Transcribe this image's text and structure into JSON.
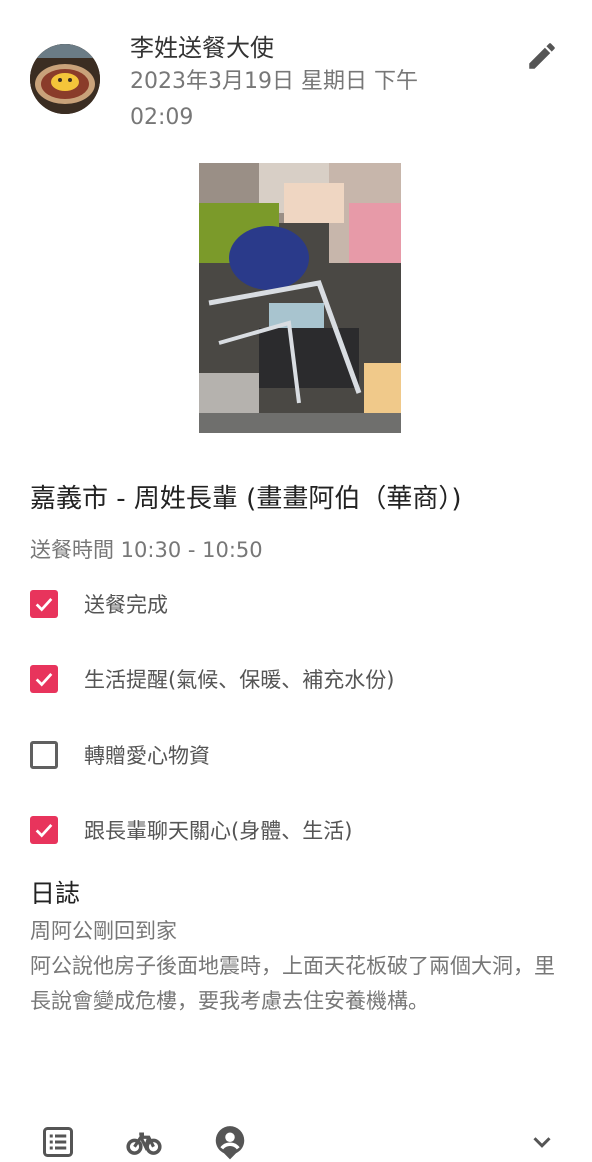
{
  "header": {
    "author_name": "李姓送餐大使",
    "date_line1": "2023年3月19日 星期日 下午",
    "date_line2": "02:09"
  },
  "post": {
    "title": "嘉義市 - 周姓長輩 (畫畫阿伯（華商）)",
    "schedule": "送餐時間 10:30 - 10:50",
    "checklist": [
      {
        "label": "送餐完成",
        "checked": true
      },
      {
        "label": "生活提醒(氣候、保暖、補充水份)",
        "checked": true
      },
      {
        "label": "轉贈愛心物資",
        "checked": false
      },
      {
        "label": "跟長輩聊天關心(身體、生活)",
        "checked": true
      }
    ]
  },
  "log": {
    "heading": "日誌",
    "line1": "周阿公剛回到家",
    "line2": "阿公說他房子後面地震時，上面天花板破了兩個大洞，里長說會變成危樓，要我考慮去住安養機構。"
  },
  "icons": {
    "edit": "pencil-icon",
    "list": "list-icon",
    "bike": "bike-icon",
    "person": "person-pin-icon",
    "expand": "chevron-down-icon"
  },
  "colors": {
    "accent": "#e8345c",
    "icon": "#555555"
  }
}
